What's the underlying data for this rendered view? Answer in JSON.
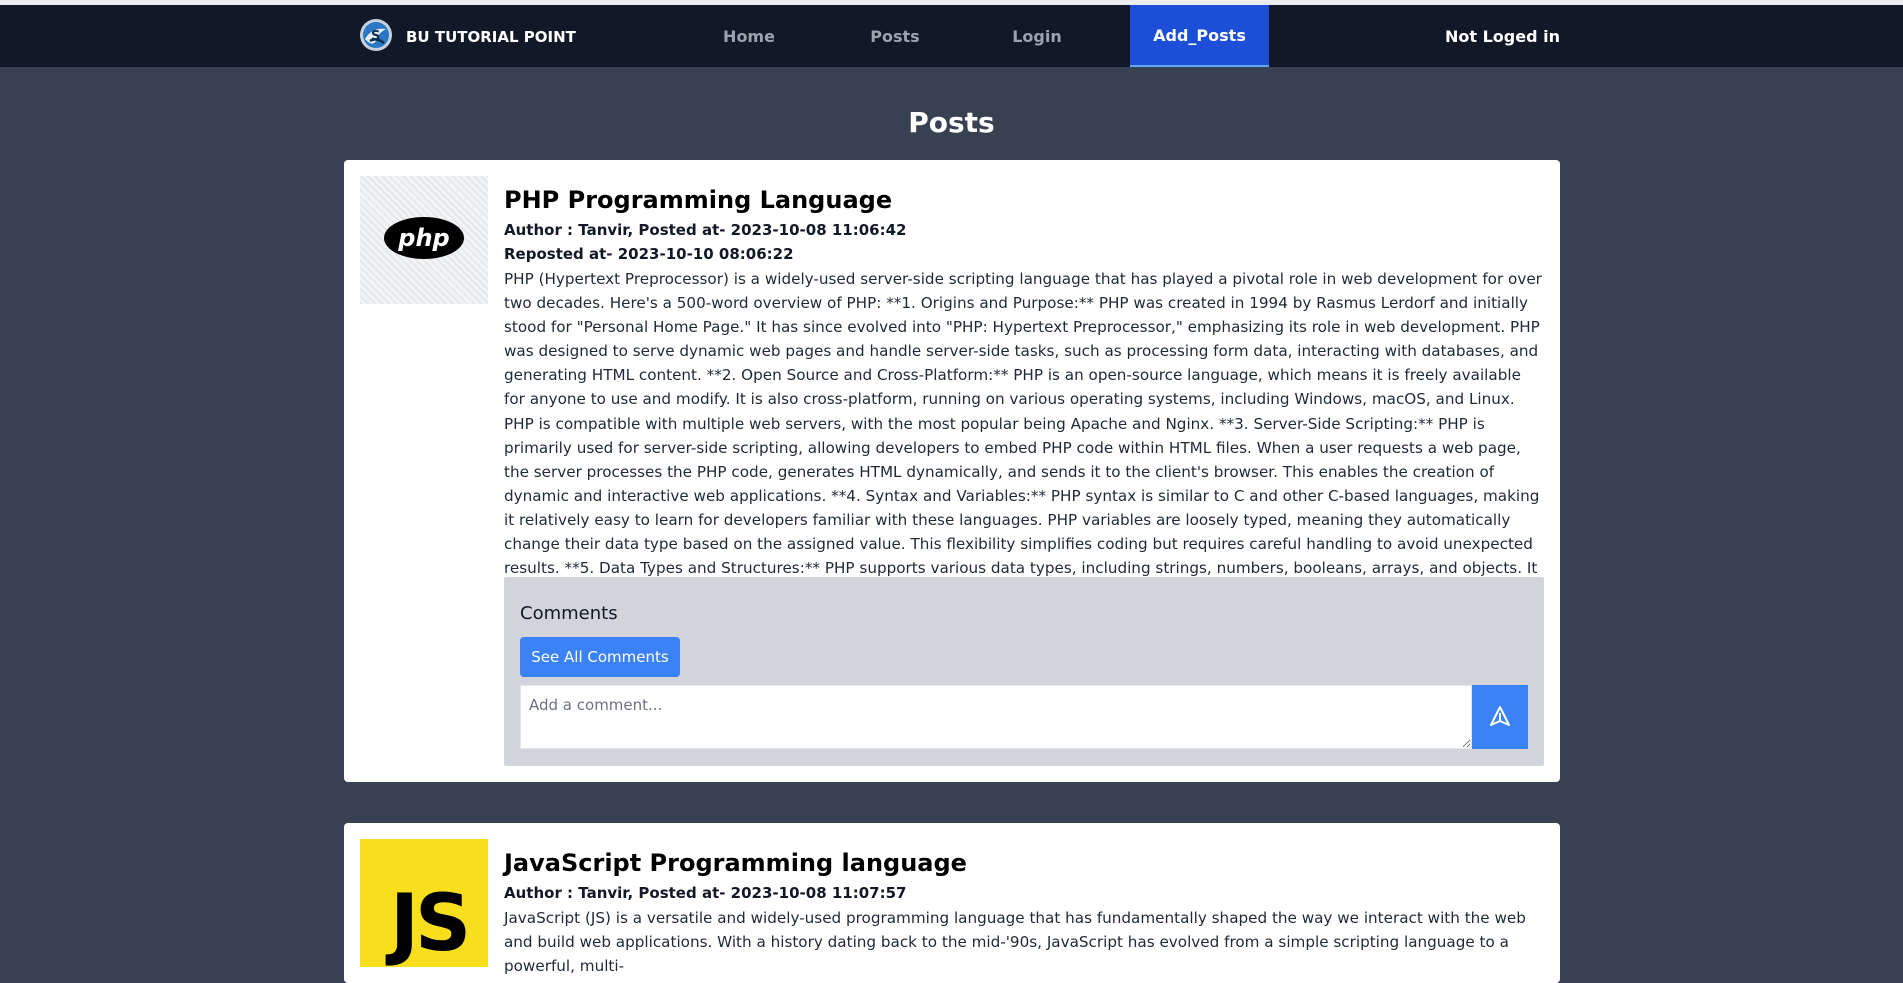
{
  "nav": {
    "brand": "BU TUTORIAL POINT",
    "links": [
      "Home",
      "Posts",
      "Login",
      "Add_Posts"
    ],
    "active": "Add_Posts",
    "status": "Not Loged in"
  },
  "page": {
    "title": "Posts"
  },
  "posts": [
    {
      "image_icon": "php-logo",
      "image_label": "php",
      "title": "PHP Programming Language",
      "meta": "Author : Tanvir, Posted at- 2023-10-08 11:06:42",
      "reposted": "Reposted at- 2023-10-10 08:06:22",
      "body": "PHP (Hypertext Preprocessor) is a widely-used server-side scripting language that has played a pivotal role in web development for over two decades. Here's a 500-word overview of PHP: **1. Origins and Purpose:** PHP was created in 1994 by Rasmus Lerdorf and initially stood for \"Personal Home Page.\" It has since evolved into \"PHP: Hypertext Preprocessor,\" emphasizing its role in web development. PHP was designed to serve dynamic web pages and handle server-side tasks, such as processing form data, interacting with databases, and generating HTML content. **2. Open Source and Cross-Platform:** PHP is an open-source language, which means it is freely available for anyone to use and modify. It is also cross-platform, running on various operating systems, including Windows, macOS, and Linux. PHP is compatible with multiple web servers, with the most popular being Apache and Nginx. **3. Server-Side Scripting:** PHP is primarily used for server-side scripting, allowing developers to embed PHP code within HTML files. When a user requests a web page, the server processes the PHP code, generates HTML dynamically, and sends it to the client's browser. This enables the creation of dynamic and interactive web applications. **4. Syntax and Variables:** PHP syntax is similar to C and other C-based languages, making it relatively easy to learn for developers familiar with these languages. PHP variables are loosely typed, meaning they automatically change their data type based on the assigned value. This flexibility simplifies coding but requires careful handling to avoid unexpected results. **5. Data Types and Structures:** PHP supports various data types, including strings, numbers, booleans, arrays, and objects. It also offers versatile data structures like associative arrays and multidimensional arrays, making it well-suited for handling complex data..",
      "comments": {
        "title": "Comments",
        "see_all": "See All Comments",
        "placeholder": "Add a comment...",
        "send_icon": "send-icon"
      }
    },
    {
      "image_icon": "js-logo",
      "image_label": "JS",
      "title": "JavaScript Programming language",
      "meta": "Author : Tanvir, Posted at- 2023-10-08 11:07:57",
      "body": "JavaScript (JS) is a versatile and widely-used programming language that has fundamentally shaped the way we interact with the web and build web applications. With a history dating back to the mid-'90s, JavaScript has evolved from a simple scripting language to a powerful, multi-"
    }
  ]
}
